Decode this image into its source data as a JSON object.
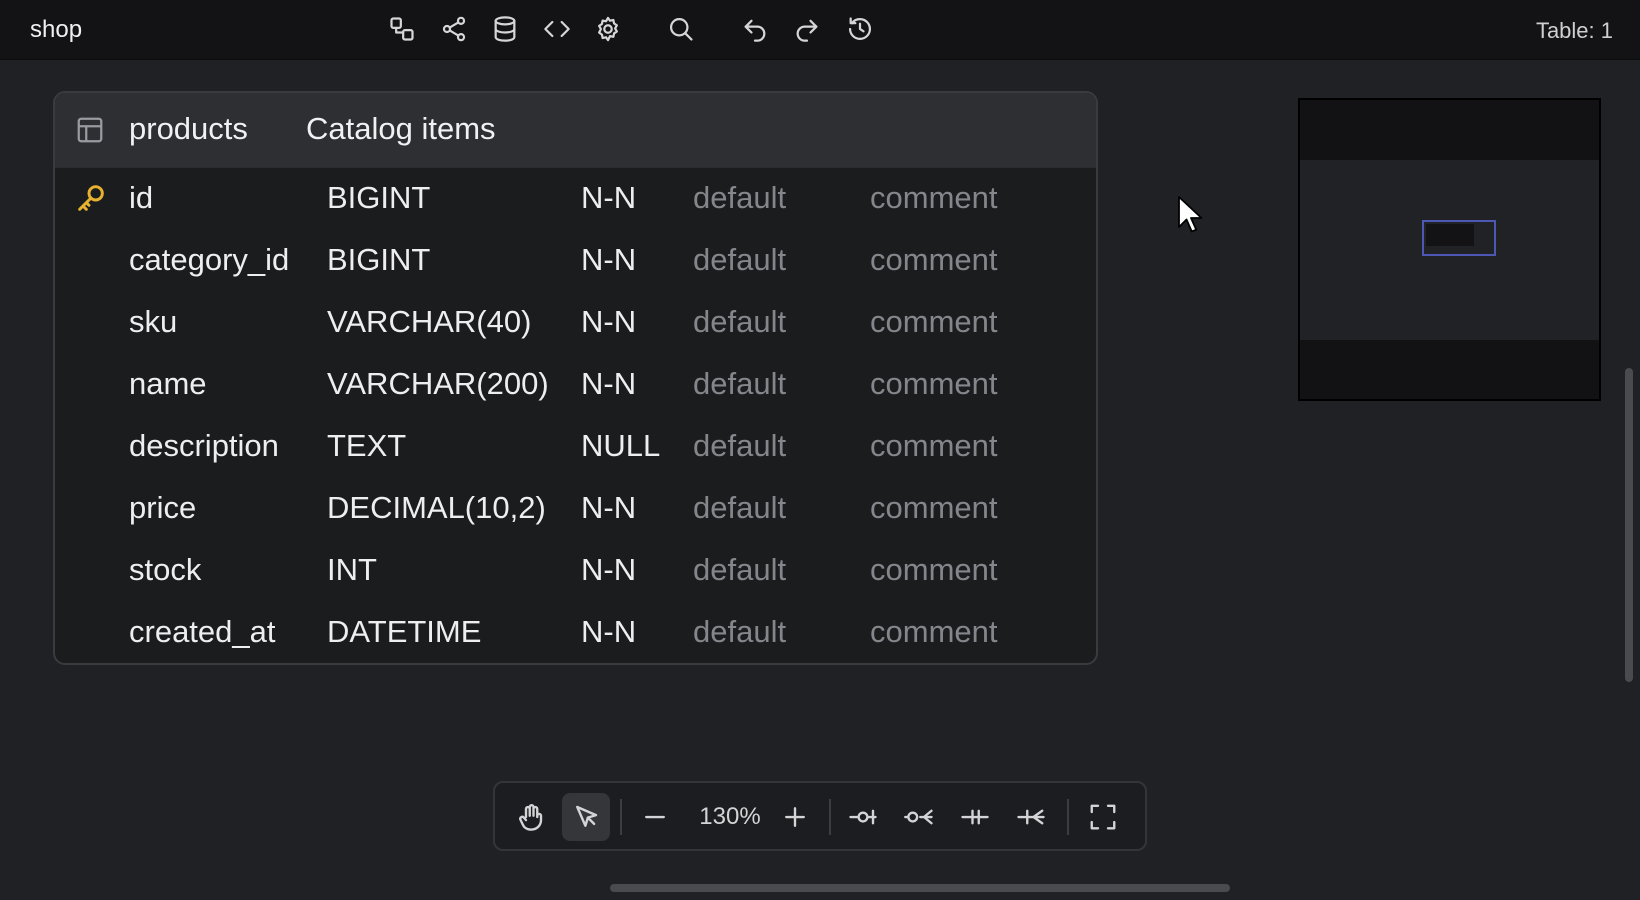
{
  "app": {
    "title": "shop",
    "table_count": "Table: 1"
  },
  "toolbar_top": {
    "icons": [
      "diagram-icon",
      "share-icon",
      "database-icon",
      "code-icon",
      "settings-icon",
      "search-icon",
      "undo-icon",
      "redo-icon",
      "history-icon"
    ]
  },
  "table": {
    "name": "products",
    "comment": "Catalog items",
    "columns": [
      {
        "name": "id",
        "type": "BIGINT",
        "null": "N-N",
        "default": "default",
        "comment": "comment",
        "primary_key": true
      },
      {
        "name": "category_id",
        "type": "BIGINT",
        "null": "N-N",
        "default": "default",
        "comment": "comment"
      },
      {
        "name": "sku",
        "type": "VARCHAR(40)",
        "null": "N-N",
        "default": "default",
        "comment": "comment"
      },
      {
        "name": "name",
        "type": "VARCHAR(200)",
        "null": "N-N",
        "default": "default",
        "comment": "comment"
      },
      {
        "name": "description",
        "type": "TEXT",
        "null": "NULL",
        "default": "default",
        "comment": "comment"
      },
      {
        "name": "price",
        "type": "DECIMAL(10,2)",
        "null": "N-N",
        "default": "default",
        "comment": "comment"
      },
      {
        "name": "stock",
        "type": "INT",
        "null": "N-N",
        "default": "default",
        "comment": "comment"
      },
      {
        "name": "created_at",
        "type": "DATETIME",
        "null": "N-N",
        "default": "default",
        "comment": "comment"
      }
    ]
  },
  "bottom_toolbar": {
    "zoom": "130%",
    "active_tool": "select"
  },
  "colors": {
    "accent_key": "#e7b22f",
    "minimap_view": "#4d58b4"
  }
}
